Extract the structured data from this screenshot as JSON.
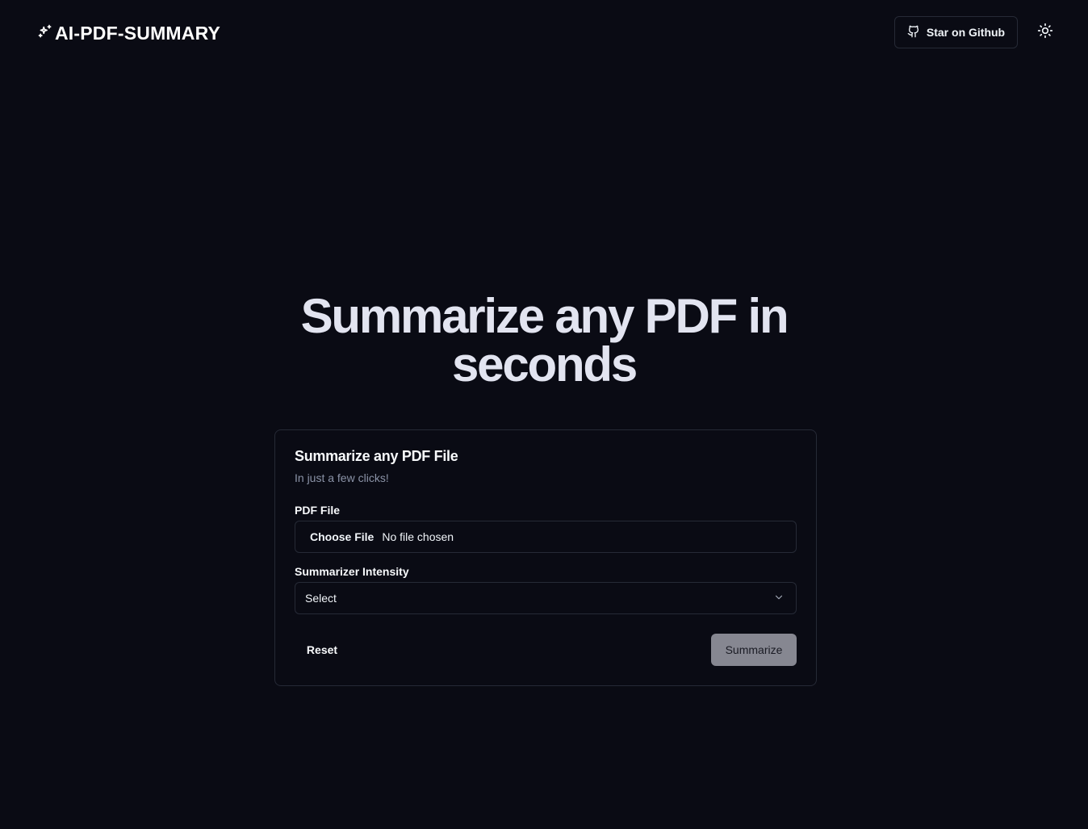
{
  "header": {
    "logo_text": "AI-PDF-SUMMARY",
    "logo_icon": "sparkles-icon",
    "github_label": "Star on Github",
    "github_icon": "github-icon",
    "theme_icon": "sun-icon"
  },
  "hero": {
    "title": "Summarize any PDF in seconds"
  },
  "card": {
    "title": "Summarize any PDF File",
    "subtitle": "In just a few clicks!",
    "pdf_label": "PDF File",
    "file_button": "Choose File",
    "file_status": "No file chosen",
    "intensity_label": "Summarizer Intensity",
    "intensity_value": "Select",
    "reset_label": "Reset",
    "submit_label": "Summarize"
  },
  "colors": {
    "background": "#0a0b14",
    "border": "#262a36",
    "muted_text": "#8b93a7",
    "disabled_button": "#868791"
  }
}
